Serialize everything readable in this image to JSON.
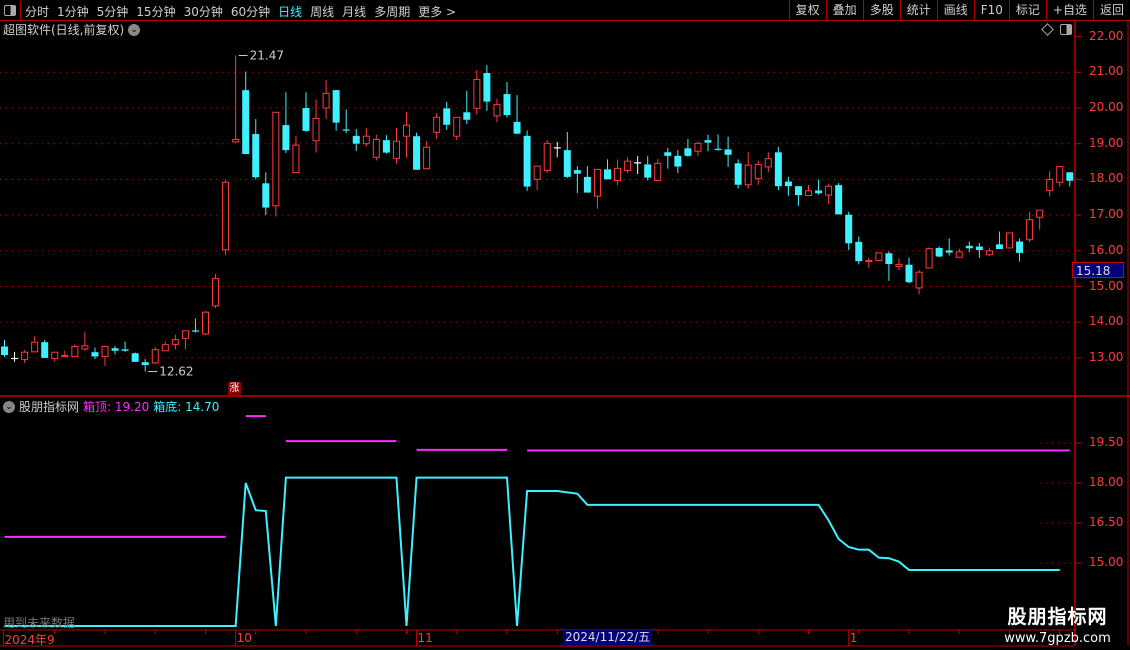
{
  "toolbar": {
    "periods": [
      "分时",
      "1分钟",
      "5分钟",
      "15分钟",
      "30分钟",
      "60分钟",
      "日线",
      "周线",
      "月线",
      "多周期",
      "更多 >"
    ],
    "active_period": "日线",
    "buttons": [
      "复权",
      "叠加",
      "多股",
      "统计",
      "画线",
      "F10",
      "标记",
      "+自选",
      "返回"
    ]
  },
  "main": {
    "title": "超图软件(日线,前复权)",
    "high_marker": "21.47",
    "low_marker": "12.62",
    "limit_badge": "涨",
    "price_tag": "15.18",
    "axis_labels": [
      "22.00",
      "21.00",
      "20.00",
      "19.00",
      "18.00",
      "17.00",
      "16.00",
      "15.00",
      "14.00",
      "13.00"
    ]
  },
  "indicator": {
    "name": "股朋指标网",
    "top_label": "箱顶: 19.20",
    "bottom_label": "箱底: 14.70",
    "axis_labels": [
      "19.50",
      "18.00",
      "16.50",
      "15.00"
    ],
    "future_note": "用到未来数据"
  },
  "date_axis": {
    "labels": [
      {
        "text": "2024年9",
        "index": 0
      },
      {
        "text": "10",
        "index": 23
      },
      {
        "text": "11",
        "index": 41
      },
      {
        "text": "1",
        "index": 84
      }
    ],
    "cursor": "2024/11/22/五"
  },
  "watermark": {
    "name": "股朋指标网",
    "url": "www.7gpzb.com"
  },
  "colors": {
    "up": "#ff3b3b",
    "down": "#3ff0ff",
    "doji": "#ffffff",
    "grid": "#b00000",
    "box_top": "#ff2bff",
    "box_bottom": "#3ff0ff"
  },
  "chart_data": [
    {
      "type": "candlestick",
      "title": "超图软件(日线,前复权)",
      "ylim": [
        12.0,
        22.2
      ],
      "fields": [
        "open",
        "high",
        "low",
        "close"
      ],
      "candles": [
        [
          13.32,
          13.5,
          13.03,
          13.08
        ],
        [
          13.0,
          13.17,
          12.89,
          13.0
        ],
        [
          12.96,
          13.22,
          12.86,
          13.16
        ],
        [
          13.17,
          13.61,
          13.17,
          13.44
        ],
        [
          13.44,
          13.5,
          13.0,
          13.0
        ],
        [
          12.98,
          13.16,
          12.89,
          13.16
        ],
        [
          13.04,
          13.2,
          13.03,
          13.07
        ],
        [
          13.04,
          13.38,
          13.04,
          13.32
        ],
        [
          13.25,
          13.74,
          13.2,
          13.34
        ],
        [
          13.16,
          13.29,
          12.97,
          13.04
        ],
        [
          13.04,
          13.34,
          12.77,
          13.32
        ],
        [
          13.27,
          13.33,
          13.1,
          13.2
        ],
        [
          13.24,
          13.46,
          13.17,
          13.2
        ],
        [
          13.13,
          13.15,
          12.89,
          12.89
        ],
        [
          12.88,
          12.97,
          12.62,
          12.8
        ],
        [
          12.86,
          13.3,
          12.82,
          13.23
        ],
        [
          13.2,
          13.46,
          13.2,
          13.37
        ],
        [
          13.38,
          13.65,
          13.24,
          13.51
        ],
        [
          13.55,
          13.76,
          13.24,
          13.76
        ],
        [
          13.77,
          14.1,
          13.71,
          13.76
        ],
        [
          13.67,
          14.31,
          13.64,
          14.28
        ],
        [
          14.46,
          15.35,
          14.4,
          15.22
        ],
        [
          16.03,
          18.0,
          15.88,
          17.92
        ],
        [
          19.05,
          21.47,
          19.03,
          19.12
        ],
        [
          20.5,
          21.02,
          18.71,
          18.71
        ],
        [
          19.27,
          19.69,
          18.0,
          18.06
        ],
        [
          17.89,
          18.2,
          17.0,
          17.21
        ],
        [
          17.26,
          19.88,
          16.96,
          19.88
        ],
        [
          19.52,
          20.44,
          18.74,
          18.82
        ],
        [
          18.19,
          19.22,
          18.19,
          18.96
        ],
        [
          20.0,
          20.44,
          19.33,
          19.36
        ],
        [
          19.08,
          20.24,
          18.75,
          19.71
        ],
        [
          20.0,
          20.78,
          19.69,
          20.41
        ],
        [
          20.5,
          20.5,
          19.36,
          19.59
        ],
        [
          19.4,
          19.96,
          19.3,
          19.39
        ],
        [
          19.22,
          19.41,
          18.8,
          19.0
        ],
        [
          19.0,
          19.44,
          18.92,
          19.21
        ],
        [
          18.62,
          19.25,
          18.53,
          19.12
        ],
        [
          19.1,
          19.24,
          18.72,
          18.75
        ],
        [
          18.59,
          19.44,
          18.44,
          19.07
        ],
        [
          19.21,
          19.89,
          18.61,
          19.52
        ],
        [
          19.21,
          19.31,
          18.27,
          18.27
        ],
        [
          18.3,
          19.07,
          18.28,
          18.9
        ],
        [
          19.32,
          19.86,
          19.14,
          19.74
        ],
        [
          19.99,
          20.17,
          19.39,
          19.53
        ],
        [
          19.21,
          19.74,
          19.1,
          19.74
        ],
        [
          19.88,
          20.48,
          19.55,
          19.67
        ],
        [
          19.99,
          21.06,
          19.81,
          20.8
        ],
        [
          20.98,
          21.2,
          19.92,
          20.18
        ],
        [
          19.78,
          20.26,
          19.6,
          20.1
        ],
        [
          20.39,
          20.73,
          19.73,
          19.8
        ],
        [
          19.61,
          20.36,
          19.28,
          19.28
        ],
        [
          19.22,
          19.37,
          17.68,
          17.8
        ],
        [
          18.0,
          18.37,
          17.7,
          18.37
        ],
        [
          18.25,
          19.1,
          18.18,
          19.01
        ],
        [
          18.9,
          19.05,
          18.62,
          18.9
        ],
        [
          18.82,
          19.33,
          18.04,
          18.07
        ],
        [
          18.26,
          18.37,
          17.62,
          18.16
        ],
        [
          18.07,
          18.37,
          17.63,
          17.63
        ],
        [
          17.53,
          18.28,
          17.18,
          18.28
        ],
        [
          18.28,
          18.56,
          18.0,
          18.0
        ],
        [
          17.97,
          18.56,
          17.84,
          18.31
        ],
        [
          18.25,
          18.62,
          18.18,
          18.51
        ],
        [
          18.48,
          18.65,
          18.15,
          18.48
        ],
        [
          18.42,
          18.65,
          17.97,
          18.05
        ],
        [
          17.97,
          18.57,
          17.97,
          18.45
        ],
        [
          18.76,
          18.88,
          18.3,
          18.66
        ],
        [
          18.66,
          18.82,
          18.18,
          18.36
        ],
        [
          18.87,
          19.13,
          18.63,
          18.66
        ],
        [
          18.79,
          19.06,
          18.66,
          19.01
        ],
        [
          19.1,
          19.25,
          18.79,
          19.03
        ],
        [
          18.86,
          19.26,
          18.8,
          18.85
        ],
        [
          18.84,
          19.2,
          18.35,
          18.69
        ],
        [
          18.45,
          18.56,
          17.74,
          17.85
        ],
        [
          17.85,
          18.76,
          17.74,
          18.4
        ],
        [
          18.02,
          18.52,
          17.85,
          18.42
        ],
        [
          18.35,
          18.76,
          18.21,
          18.58
        ],
        [
          18.76,
          18.91,
          17.7,
          17.81
        ],
        [
          17.94,
          18.07,
          17.54,
          17.81
        ],
        [
          17.81,
          17.81,
          17.26,
          17.56
        ],
        [
          17.55,
          17.84,
          17.55,
          17.68
        ],
        [
          17.69,
          18.0,
          17.57,
          17.61
        ],
        [
          17.56,
          17.87,
          17.31,
          17.81
        ],
        [
          17.84,
          17.9,
          17.02,
          17.02
        ],
        [
          17.01,
          17.09,
          16.02,
          16.21
        ],
        [
          16.25,
          16.4,
          15.62,
          15.71
        ],
        [
          15.7,
          15.81,
          15.52,
          15.73
        ],
        [
          15.73,
          15.94,
          15.71,
          15.94
        ],
        [
          15.93,
          15.98,
          15.16,
          15.63
        ],
        [
          15.56,
          15.79,
          15.46,
          15.62
        ],
        [
          15.61,
          15.81,
          15.09,
          15.12
        ],
        [
          14.96,
          15.46,
          14.78,
          15.4
        ],
        [
          15.52,
          16.09,
          15.52,
          16.06
        ],
        [
          16.08,
          16.12,
          15.82,
          15.84
        ],
        [
          16.01,
          16.35,
          15.87,
          15.95
        ],
        [
          15.82,
          16.06,
          15.82,
          15.97
        ],
        [
          16.14,
          16.26,
          15.96,
          16.07
        ],
        [
          16.12,
          16.22,
          15.8,
          16.02
        ],
        [
          15.89,
          16.09,
          15.85,
          16.0
        ],
        [
          16.18,
          16.54,
          16.05,
          16.05
        ],
        [
          16.08,
          16.5,
          16.08,
          16.5
        ],
        [
          16.26,
          16.34,
          15.7,
          15.94
        ],
        [
          16.31,
          17.09,
          16.24,
          16.87
        ],
        [
          16.94,
          17.14,
          16.59,
          17.14
        ],
        [
          17.69,
          18.23,
          17.52,
          18.0
        ],
        [
          17.92,
          18.36,
          17.8,
          18.36
        ],
        [
          18.2,
          18.2,
          17.8,
          17.96
        ]
      ]
    },
    {
      "type": "line",
      "title": "股朋指标网",
      "ylim": [
        13.3,
        20.5
      ],
      "series": [
        {
          "name": "箱底",
          "color": "#3ff0ff",
          "values": [
            12.64,
            12.64,
            12.64,
            12.64,
            12.64,
            12.64,
            12.64,
            12.64,
            12.64,
            12.64,
            12.64,
            12.64,
            12.64,
            12.64,
            12.64,
            12.64,
            12.64,
            12.64,
            12.64,
            12.64,
            12.64,
            12.64,
            12.64,
            12.64,
            18.0,
            16.98,
            16.95,
            12.64,
            18.2,
            18.2,
            18.2,
            18.2,
            18.2,
            18.2,
            18.2,
            18.2,
            18.2,
            18.2,
            18.2,
            18.2,
            12.64,
            18.2,
            18.2,
            18.2,
            18.2,
            18.2,
            18.2,
            18.2,
            18.2,
            18.2,
            18.2,
            12.64,
            17.7,
            17.7,
            17.7,
            17.7,
            17.65,
            17.6,
            17.18,
            17.18,
            17.18,
            17.18,
            17.18,
            17.18,
            17.18,
            17.18,
            17.18,
            17.18,
            17.18,
            17.18,
            17.18,
            17.18,
            17.18,
            17.18,
            17.18,
            17.18,
            17.18,
            17.18,
            17.18,
            17.18,
            17.18,
            17.18,
            16.6,
            15.9,
            15.6,
            15.5,
            15.5,
            15.2,
            15.18,
            15.05,
            14.74,
            14.74,
            14.74,
            14.74,
            14.74,
            14.74,
            14.74,
            14.74,
            14.74,
            14.74,
            14.74,
            14.74,
            14.74,
            14.74,
            14.74,
            14.74
          ]
        }
      ],
      "segments": [
        {
          "name": "箱顶",
          "color": "#ff2bff",
          "from": 0,
          "to": 22,
          "value": 15.98
        },
        {
          "name": "箱顶",
          "color": "#ff2bff",
          "from": 24,
          "to": 26,
          "value": 20.51
        },
        {
          "name": "箱顶",
          "color": "#ff2bff",
          "from": 28,
          "to": 39,
          "value": 19.57
        },
        {
          "name": "箱顶",
          "color": "#ff2bff",
          "from": 41,
          "to": 50,
          "value": 19.24
        },
        {
          "name": "箱顶",
          "color": "#ff2bff",
          "from": 52,
          "to": 106,
          "value": 19.22
        }
      ]
    }
  ]
}
